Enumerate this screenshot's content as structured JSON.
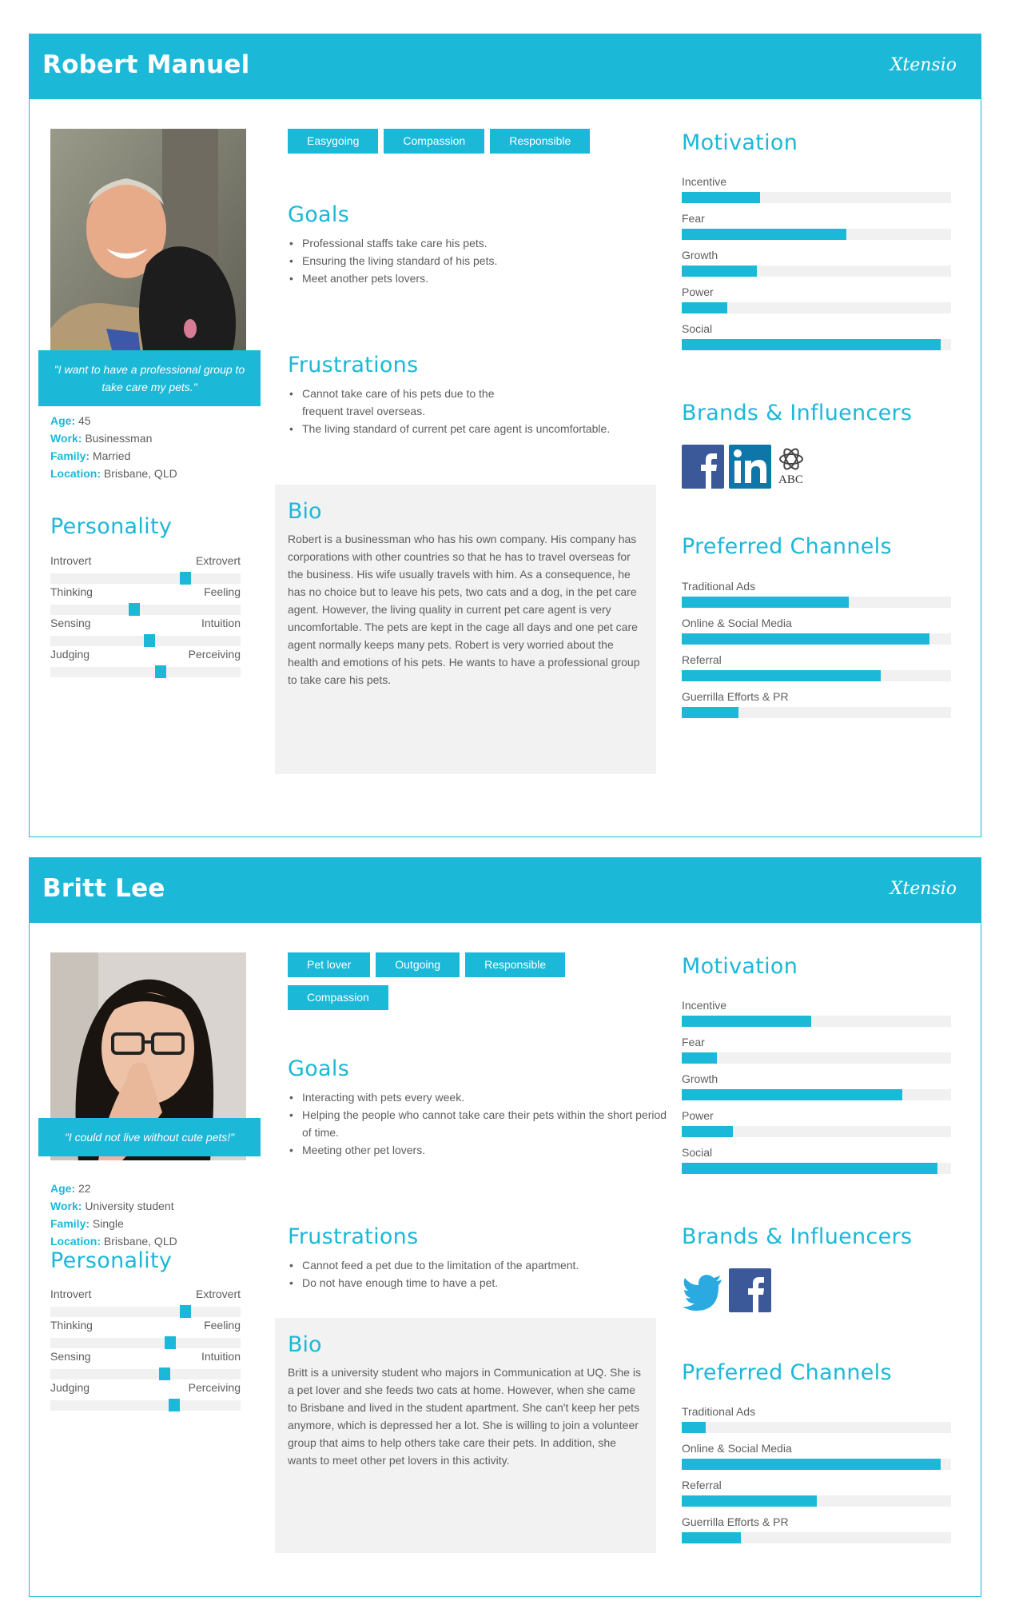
{
  "personas": [
    {
      "name": "Robert Manuel",
      "logo": "Xtensio",
      "photo": "photo of man holding a black dog",
      "quote": "\"I want to have a professional group to take care my pets.\"",
      "info": {
        "age_label": "Age:",
        "age": "45",
        "work_label": "Work:",
        "work": "Businessman",
        "family_label": "Family:",
        "family": "Married",
        "location_label": "Location:",
        "location": "Brisbane, QLD"
      },
      "personality_title": "Personality",
      "personality": [
        {
          "left": "Introvert",
          "right": "Extrovert",
          "value": 0.71
        },
        {
          "left": "Thinking",
          "right": "Feeling",
          "value": 0.44
        },
        {
          "left": "Sensing",
          "right": "Intuition",
          "value": 0.52
        },
        {
          "left": "Judging",
          "right": "Perceiving",
          "value": 0.58
        }
      ],
      "tags": [
        "Easygoing",
        "Compassion",
        "Responsible"
      ],
      "goals_title": "Goals",
      "goals": [
        "Professional staffs take care his pets.",
        "Ensuring the living standard of his pets.",
        "Meet another pets lovers."
      ],
      "frustrations_title": "Frustrations",
      "frustrations": [
        "Cannot take care of his pets due to the frequent travel overseas.",
        "The living standard of current pet care agent is uncomfortable."
      ],
      "bio_title": "Bio",
      "bio": "Robert is a businessman who has his own company. His company has corporations with other countries so that he has to travel overseas for the business. His wife usually travels with him. As a consequence, he has no choice but to leave his pets, two cats and a dog, in the pet care agent. However, the living quality in current pet care agent is very uncomfortable. The pets are kept in the cage all days and one pet care agent normally keeps many pets. Robert is very worried about the health and emotions of his pets. He wants to have a professional group to take care his pets.",
      "motivation_title": "Motivation",
      "motivation": [
        {
          "label": "Incentive",
          "value": 0.29
        },
        {
          "label": "Fear",
          "value": 0.61
        },
        {
          "label": "Growth",
          "value": 0.28
        },
        {
          "label": "Power",
          "value": 0.17
        },
        {
          "label": "Social",
          "value": 0.96
        }
      ],
      "brands_title": "Brands & Influencers",
      "brands": [
        "facebook-icon",
        "linkedin-icon",
        "abc-icon"
      ],
      "brand_abc_text": "ABC",
      "channels_title": "Preferred Channels",
      "channels": [
        {
          "label": "Traditional Ads",
          "value": 0.62
        },
        {
          "label": "Online & Social Media",
          "value": 0.92
        },
        {
          "label": "Referral",
          "value": 0.74
        },
        {
          "label": "Guerrilla Efforts & PR",
          "value": 0.21
        }
      ]
    },
    {
      "name": "Britt Lee",
      "logo": "Xtensio",
      "photo": "photo of young woman with glasses",
      "quote": "\"I could not live without cute pets!\"",
      "info": {
        "age_label": "Age:",
        "age": "22",
        "work_label": "Work:",
        "work": "University student",
        "family_label": "Family:",
        "family": "Single",
        "location_label": "Location:",
        "location": "Brisbane, QLD"
      },
      "personality_title": "Personality",
      "personality": [
        {
          "left": "Introvert",
          "right": "Extrovert",
          "value": 0.71
        },
        {
          "left": "Thinking",
          "right": "Feeling",
          "value": 0.63
        },
        {
          "left": "Sensing",
          "right": "Intuition",
          "value": 0.6
        },
        {
          "left": "Judging",
          "right": "Perceiving",
          "value": 0.65
        }
      ],
      "tags": [
        "Pet lover",
        "Outgoing",
        "Responsible",
        "Compassion"
      ],
      "goals_title": "Goals",
      "goals": [
        "Interacting with pets every week.",
        "Helping the people who cannot take care their pets within the short period of time.",
        "Meeting other pet lovers."
      ],
      "frustrations_title": "Frustrations",
      "frustrations": [
        "Cannot feed a pet due to the limitation of the apartment.",
        "Do not have enough time to have a pet."
      ],
      "bio_title": "Bio",
      "bio": "Britt is a university student who majors in Communication at UQ. She is a pet lover and she feeds two cats at home. However, when she came to Brisbane and lived in the student apartment. She can't keep her pets anymore, which is depressed her a lot. She is willing to join a volunteer group that aims to help others take care their pets. In addition, she wants to meet other pet lovers in this activity.",
      "motivation_title": "Motivation",
      "motivation": [
        {
          "label": "Incentive",
          "value": 0.48
        },
        {
          "label": "Fear",
          "value": 0.13
        },
        {
          "label": "Growth",
          "value": 0.82
        },
        {
          "label": "Power",
          "value": 0.19
        },
        {
          "label": "Social",
          "value": 0.95
        }
      ],
      "brands_title": "Brands & Influencers",
      "brands": [
        "twitter-icon",
        "facebook-icon"
      ],
      "channels_title": "Preferred Channels",
      "channels": [
        {
          "label": "Traditional Ads",
          "value": 0.09
        },
        {
          "label": "Online & Social Media",
          "value": 0.96
        },
        {
          "label": "Referral",
          "value": 0.5
        },
        {
          "label": "Guerrilla Efforts & PR",
          "value": 0.22
        }
      ]
    }
  ]
}
